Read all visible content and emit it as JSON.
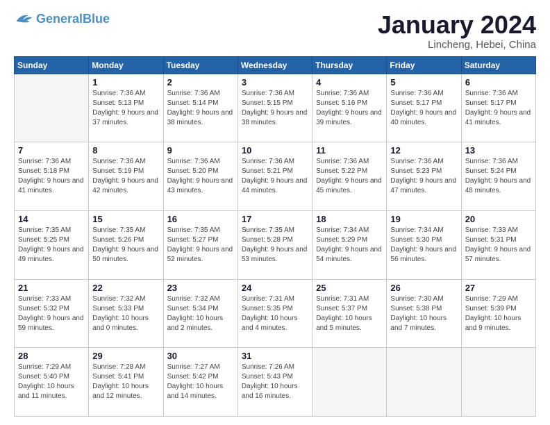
{
  "logo": {
    "general": "General",
    "blue": "Blue"
  },
  "title": "January 2024",
  "location": "Lincheng, Hebei, China",
  "weekdays": [
    "Sunday",
    "Monday",
    "Tuesday",
    "Wednesday",
    "Thursday",
    "Friday",
    "Saturday"
  ],
  "weeks": [
    [
      {
        "day": "",
        "sunrise": "",
        "sunset": "",
        "daylight": "",
        "empty": true
      },
      {
        "day": "1",
        "sunrise": "Sunrise: 7:36 AM",
        "sunset": "Sunset: 5:13 PM",
        "daylight": "Daylight: 9 hours and 37 minutes."
      },
      {
        "day": "2",
        "sunrise": "Sunrise: 7:36 AM",
        "sunset": "Sunset: 5:14 PM",
        "daylight": "Daylight: 9 hours and 38 minutes."
      },
      {
        "day": "3",
        "sunrise": "Sunrise: 7:36 AM",
        "sunset": "Sunset: 5:15 PM",
        "daylight": "Daylight: 9 hours and 38 minutes."
      },
      {
        "day": "4",
        "sunrise": "Sunrise: 7:36 AM",
        "sunset": "Sunset: 5:16 PM",
        "daylight": "Daylight: 9 hours and 39 minutes."
      },
      {
        "day": "5",
        "sunrise": "Sunrise: 7:36 AM",
        "sunset": "Sunset: 5:17 PM",
        "daylight": "Daylight: 9 hours and 40 minutes."
      },
      {
        "day": "6",
        "sunrise": "Sunrise: 7:36 AM",
        "sunset": "Sunset: 5:17 PM",
        "daylight": "Daylight: 9 hours and 41 minutes."
      }
    ],
    [
      {
        "day": "7",
        "sunrise": "Sunrise: 7:36 AM",
        "sunset": "Sunset: 5:18 PM",
        "daylight": "Daylight: 9 hours and 41 minutes."
      },
      {
        "day": "8",
        "sunrise": "Sunrise: 7:36 AM",
        "sunset": "Sunset: 5:19 PM",
        "daylight": "Daylight: 9 hours and 42 minutes."
      },
      {
        "day": "9",
        "sunrise": "Sunrise: 7:36 AM",
        "sunset": "Sunset: 5:20 PM",
        "daylight": "Daylight: 9 hours and 43 minutes."
      },
      {
        "day": "10",
        "sunrise": "Sunrise: 7:36 AM",
        "sunset": "Sunset: 5:21 PM",
        "daylight": "Daylight: 9 hours and 44 minutes."
      },
      {
        "day": "11",
        "sunrise": "Sunrise: 7:36 AM",
        "sunset": "Sunset: 5:22 PM",
        "daylight": "Daylight: 9 hours and 45 minutes."
      },
      {
        "day": "12",
        "sunrise": "Sunrise: 7:36 AM",
        "sunset": "Sunset: 5:23 PM",
        "daylight": "Daylight: 9 hours and 47 minutes."
      },
      {
        "day": "13",
        "sunrise": "Sunrise: 7:36 AM",
        "sunset": "Sunset: 5:24 PM",
        "daylight": "Daylight: 9 hours and 48 minutes."
      }
    ],
    [
      {
        "day": "14",
        "sunrise": "Sunrise: 7:35 AM",
        "sunset": "Sunset: 5:25 PM",
        "daylight": "Daylight: 9 hours and 49 minutes."
      },
      {
        "day": "15",
        "sunrise": "Sunrise: 7:35 AM",
        "sunset": "Sunset: 5:26 PM",
        "daylight": "Daylight: 9 hours and 50 minutes."
      },
      {
        "day": "16",
        "sunrise": "Sunrise: 7:35 AM",
        "sunset": "Sunset: 5:27 PM",
        "daylight": "Daylight: 9 hours and 52 minutes."
      },
      {
        "day": "17",
        "sunrise": "Sunrise: 7:35 AM",
        "sunset": "Sunset: 5:28 PM",
        "daylight": "Daylight: 9 hours and 53 minutes."
      },
      {
        "day": "18",
        "sunrise": "Sunrise: 7:34 AM",
        "sunset": "Sunset: 5:29 PM",
        "daylight": "Daylight: 9 hours and 54 minutes."
      },
      {
        "day": "19",
        "sunrise": "Sunrise: 7:34 AM",
        "sunset": "Sunset: 5:30 PM",
        "daylight": "Daylight: 9 hours and 56 minutes."
      },
      {
        "day": "20",
        "sunrise": "Sunrise: 7:33 AM",
        "sunset": "Sunset: 5:31 PM",
        "daylight": "Daylight: 9 hours and 57 minutes."
      }
    ],
    [
      {
        "day": "21",
        "sunrise": "Sunrise: 7:33 AM",
        "sunset": "Sunset: 5:32 PM",
        "daylight": "Daylight: 9 hours and 59 minutes."
      },
      {
        "day": "22",
        "sunrise": "Sunrise: 7:32 AM",
        "sunset": "Sunset: 5:33 PM",
        "daylight": "Daylight: 10 hours and 0 minutes."
      },
      {
        "day": "23",
        "sunrise": "Sunrise: 7:32 AM",
        "sunset": "Sunset: 5:34 PM",
        "daylight": "Daylight: 10 hours and 2 minutes."
      },
      {
        "day": "24",
        "sunrise": "Sunrise: 7:31 AM",
        "sunset": "Sunset: 5:35 PM",
        "daylight": "Daylight: 10 hours and 4 minutes."
      },
      {
        "day": "25",
        "sunrise": "Sunrise: 7:31 AM",
        "sunset": "Sunset: 5:37 PM",
        "daylight": "Daylight: 10 hours and 5 minutes."
      },
      {
        "day": "26",
        "sunrise": "Sunrise: 7:30 AM",
        "sunset": "Sunset: 5:38 PM",
        "daylight": "Daylight: 10 hours and 7 minutes."
      },
      {
        "day": "27",
        "sunrise": "Sunrise: 7:29 AM",
        "sunset": "Sunset: 5:39 PM",
        "daylight": "Daylight: 10 hours and 9 minutes."
      }
    ],
    [
      {
        "day": "28",
        "sunrise": "Sunrise: 7:29 AM",
        "sunset": "Sunset: 5:40 PM",
        "daylight": "Daylight: 10 hours and 11 minutes."
      },
      {
        "day": "29",
        "sunrise": "Sunrise: 7:28 AM",
        "sunset": "Sunset: 5:41 PM",
        "daylight": "Daylight: 10 hours and 12 minutes."
      },
      {
        "day": "30",
        "sunrise": "Sunrise: 7:27 AM",
        "sunset": "Sunset: 5:42 PM",
        "daylight": "Daylight: 10 hours and 14 minutes."
      },
      {
        "day": "31",
        "sunrise": "Sunrise: 7:26 AM",
        "sunset": "Sunset: 5:43 PM",
        "daylight": "Daylight: 10 hours and 16 minutes."
      },
      {
        "day": "",
        "sunrise": "",
        "sunset": "",
        "daylight": "",
        "empty": true
      },
      {
        "day": "",
        "sunrise": "",
        "sunset": "",
        "daylight": "",
        "empty": true
      },
      {
        "day": "",
        "sunrise": "",
        "sunset": "",
        "daylight": "",
        "empty": true
      }
    ]
  ]
}
